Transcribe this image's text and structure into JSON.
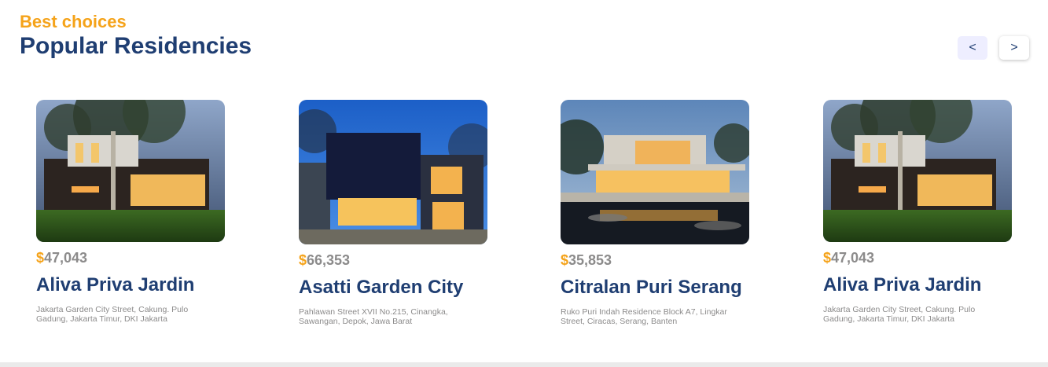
{
  "header": {
    "eyebrow": "Best choices",
    "title": "Popular Residencies",
    "prev_label": "<",
    "next_label": ">"
  },
  "residencies": [
    {
      "currency": "$",
      "price": "47,043",
      "name": "Aliva Priva Jardin",
      "address": "Jakarta Garden City Street, Cakung. Pulo Gadung, Jakarta Timur, DKI Jakarta",
      "image": "house-with-tree-photo"
    },
    {
      "currency": "$",
      "price": "66,353",
      "name": "Asatti Garden City",
      "address": "Pahlawan Street XVII No.215, Cinangka, Sawangan, Depok, Jawa Barat",
      "image": "modern-dark-house-photo"
    },
    {
      "currency": "$",
      "price": "35,853",
      "name": "Citralan Puri Serang",
      "address": "Ruko Puri Indah Residence Block A7, Lingkar Street, Ciracas, Serang, Banten",
      "image": "house-with-pond-photo"
    },
    {
      "currency": "$",
      "price": "47,043",
      "name": "Aliva Priva Jardin",
      "address": "Jakarta Garden City Street, Cakung. Pulo Gadung, Jakarta Timur, DKI Jakarta",
      "image": "house-with-tree-photo"
    }
  ],
  "colors": {
    "accent": "#f5a31a",
    "title": "#1f3e72",
    "muted": "#8c8b8b"
  }
}
